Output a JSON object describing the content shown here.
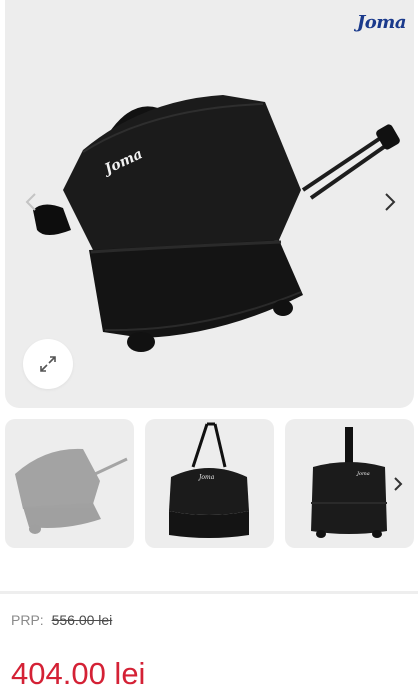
{
  "brand": {
    "logo_text": "Joma",
    "color": "#1a3a8c"
  },
  "gallery": {
    "main_image": "black-trolley-sports-bag",
    "bag_logo_text": "Joma",
    "prev_icon": "chevron-left-icon",
    "next_icon": "chevron-right-icon",
    "zoom_icon": "expand-arrows-icon"
  },
  "thumbnails": [
    {
      "image": "trolley-bag-side-view",
      "state": "selected-faded"
    },
    {
      "image": "bag-front-with-strap"
    },
    {
      "image": "trolley-upright-view"
    }
  ],
  "pricing": {
    "prp_label": "PRP:",
    "prp_value": "556.00 lei",
    "price": "404.00 lei",
    "price_color": "#d42135"
  }
}
